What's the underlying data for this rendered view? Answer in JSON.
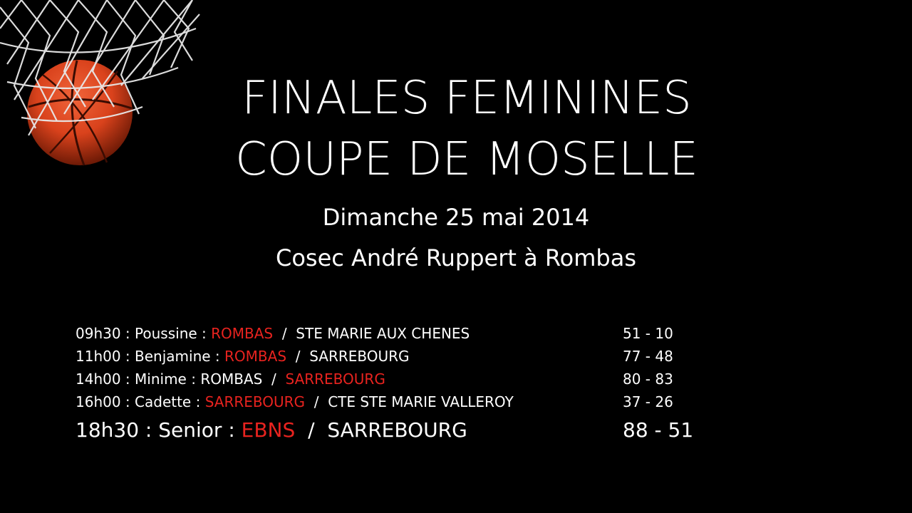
{
  "title_line1": "FINALES FEMININES",
  "title_line2": "COUPE DE MOSELLE",
  "date": "Dimanche 25 mai 2014",
  "venue": "Cosec André Ruppert à Rombas",
  "colors": {
    "background": "#000000",
    "text": "#ffffff",
    "winner": "#e8231f",
    "ball": "#d9421c"
  },
  "matches": [
    {
      "time": "09h30",
      "category": "Poussine",
      "team_a": "ROMBAS",
      "team_b": "STE MARIE AUX CHENES",
      "winner": "a",
      "score": "51 - 10"
    },
    {
      "time": "11h00",
      "category": "Benjamine",
      "team_a": "ROMBAS",
      "team_b": "SARREBOURG",
      "winner": "a",
      "score": "77 - 48"
    },
    {
      "time": "14h00",
      "category": "Minime",
      "team_a": "ROMBAS",
      "team_b": "SARREBOURG",
      "winner": "b",
      "score": "80 - 83"
    },
    {
      "time": "16h00",
      "category": "Cadette",
      "team_a": "SARREBOURG",
      "team_b": "CTE STE MARIE VALLEROY",
      "winner": "a",
      "score": "37 - 26"
    },
    {
      "time": "18h30",
      "category": "Senior",
      "team_a": "EBNS",
      "team_b": "SARREBOURG",
      "winner": "a",
      "score": "88 - 51"
    }
  ]
}
